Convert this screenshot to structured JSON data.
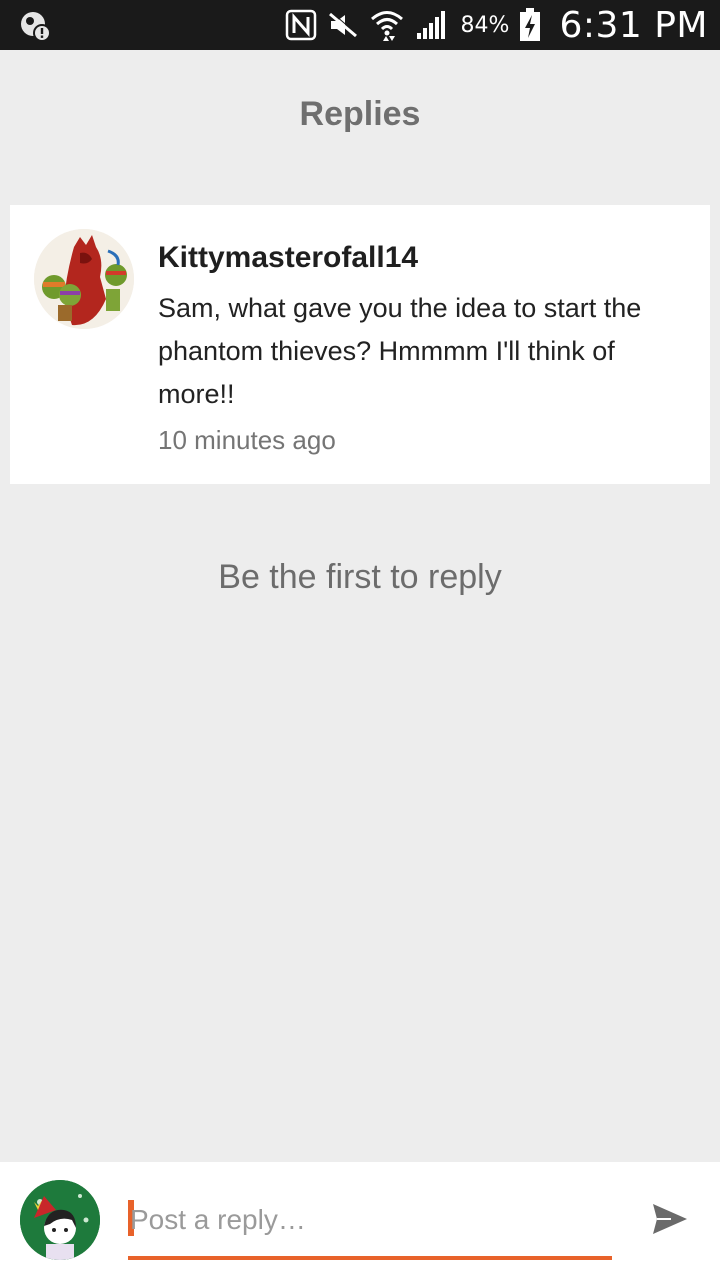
{
  "status_bar": {
    "battery_percent": "84%",
    "time": "6:31 PM",
    "icons": [
      "notification-alert-icon",
      "nfc-icon",
      "mute-icon",
      "wifi-icon",
      "signal-icon",
      "battery-charging-icon"
    ]
  },
  "header": {
    "title": "Replies"
  },
  "comment": {
    "username": "Kittymasterofall14",
    "text": "Sam, what gave you the idea to start the phantom thieves? Hmmmm I'll think of more!!",
    "timestamp": "10 minutes ago"
  },
  "empty_state": {
    "message": "Be the first to reply"
  },
  "reply_bar": {
    "placeholder": "Post a reply…",
    "value": "",
    "accent_color": "#e8622a"
  }
}
